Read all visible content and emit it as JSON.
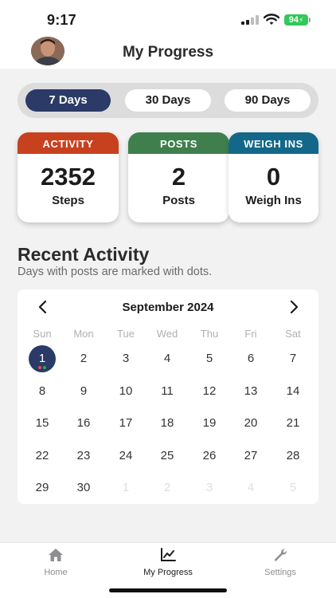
{
  "status_bar": {
    "time": "9:17",
    "battery": "94"
  },
  "header": {
    "title": "My Progress"
  },
  "ranges": [
    {
      "label": "7 Days",
      "active": true
    },
    {
      "label": "30 Days",
      "active": false
    },
    {
      "label": "90 Days",
      "active": false
    }
  ],
  "stats": [
    {
      "header": "ACTIVITY",
      "value": "2352",
      "label": "Steps",
      "color": "#c8411f"
    },
    {
      "header": "POSTS",
      "value": "2",
      "label": "Posts",
      "color": "#3f7f4e"
    },
    {
      "header": "WEIGH INS",
      "value": "0",
      "label": "Weigh Ins",
      "color": "#13688a"
    }
  ],
  "recent": {
    "title": "Recent Activity",
    "subtitle": "Days with posts are marked with dots."
  },
  "calendar": {
    "month_label": "September 2024",
    "weekdays": [
      "Sun",
      "Mon",
      "Tue",
      "Wed",
      "Thu",
      "Fri",
      "Sat"
    ],
    "weeks": [
      [
        "1",
        "2",
        "3",
        "4",
        "5",
        "6",
        "7"
      ],
      [
        "8",
        "9",
        "10",
        "11",
        "12",
        "13",
        "14"
      ],
      [
        "15",
        "16",
        "17",
        "18",
        "19",
        "20",
        "21"
      ],
      [
        "22",
        "23",
        "24",
        "25",
        "26",
        "27",
        "28"
      ],
      [
        "29",
        "30",
        "1",
        "2",
        "3",
        "4",
        "5"
      ]
    ],
    "selected_day": "1",
    "post_dot_colors": [
      "#e5533d",
      "#2ea84e"
    ]
  },
  "tabs": [
    {
      "label": "Home",
      "icon": "home-icon",
      "active": false
    },
    {
      "label": "My Progress",
      "icon": "chart-line-icon",
      "active": true
    },
    {
      "label": "Settings",
      "icon": "wrench-icon",
      "active": false
    }
  ],
  "colors": {
    "accent": "#2b3a67",
    "tab_active": "#1c1c1e",
    "tab_inactive": "#8e8e93"
  }
}
